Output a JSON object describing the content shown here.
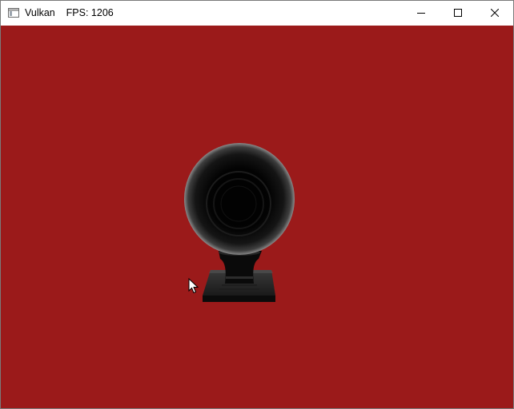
{
  "window": {
    "title": "Vulkan",
    "status": "FPS: 1206"
  },
  "caption_buttons": {
    "minimize_icon": "minimize-icon",
    "maximize_icon": "maximize-icon",
    "close_icon": "close-icon"
  },
  "viewport": {
    "clear_color": "#9b1a1a",
    "model": "black glossy sphere on pedestal stand"
  },
  "cursor": {
    "icon": "arrow-cursor-icon"
  }
}
